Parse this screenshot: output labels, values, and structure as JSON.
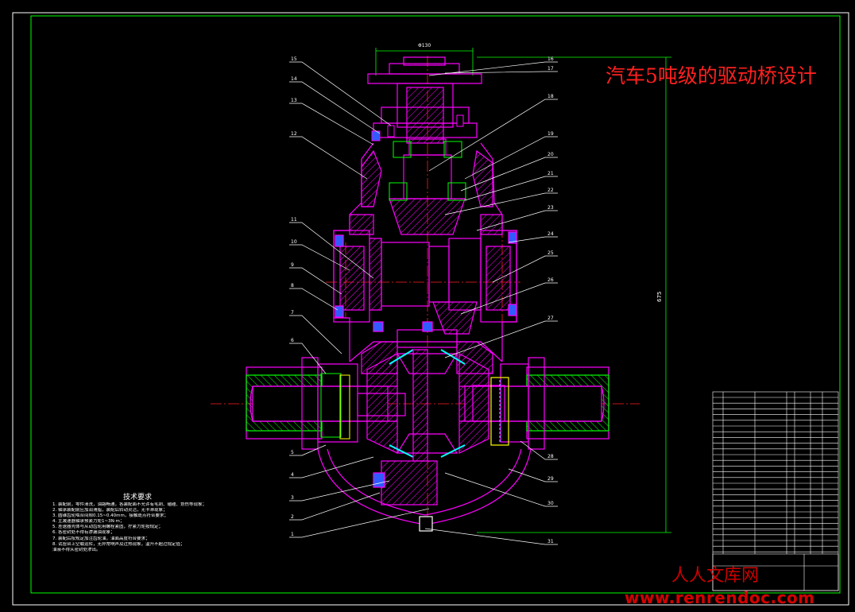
{
  "drawing": {
    "title": "汽车5吨级的驱动桥设计",
    "overall_dimension_horizontal": "Φ130",
    "overall_dimension_vertical": "675"
  },
  "balloons_left": [
    "15",
    "14",
    "13",
    "12",
    "11",
    "10",
    "9",
    "8",
    "7",
    "6",
    "5",
    "4",
    "3",
    "2",
    "1"
  ],
  "balloons_right": [
    "16",
    "17",
    "18",
    "19",
    "20",
    "21",
    "22",
    "23",
    "24",
    "25",
    "26",
    "27",
    "28",
    "29",
    "30",
    "31"
  ],
  "technical_requirements": {
    "heading": "技术要求",
    "lines": [
      "1. 装配前，零件清洗，油路畅通，各装配面不允许有毛刺、磕碰、划伤等现象；",
      "2. 轴承装配前应加润滑脂，装配后转动灵活，无卡滞现象；",
      "3. 圆锥齿轮啮合间隙0.15~0.40mm，接触斑点符合要求；",
      "4. 主减速器轴承预紧力矩1~3N·m；",
      "5. 差速器壳体与从动齿轮用螺栓紧固，拧紧力矩按规定；",
      "6. 各密封处不得有渗漏油现象；",
      "7. 装配后按规定加注齿轮油，油面高度符合要求；",
      "8. 试验台上空载运转，无异常响声及过热现象，温升不超过规定值；",
      "   油液不得从密封处渗出。"
    ]
  },
  "watermark": {
    "line1": "人人文库网",
    "line2": "www.renrendoc.com"
  },
  "colors": {
    "background": "#000000",
    "frame": "#00ff00",
    "outline": "#ff00ff",
    "centerline": "#ff2020",
    "hatch": "#ff00ff",
    "leader": "#ffffff",
    "accent_cyan": "#00ffff",
    "accent_blue": "#2f5bff",
    "accent_yellow": "#ffff00",
    "title_red": "#ff2020"
  }
}
